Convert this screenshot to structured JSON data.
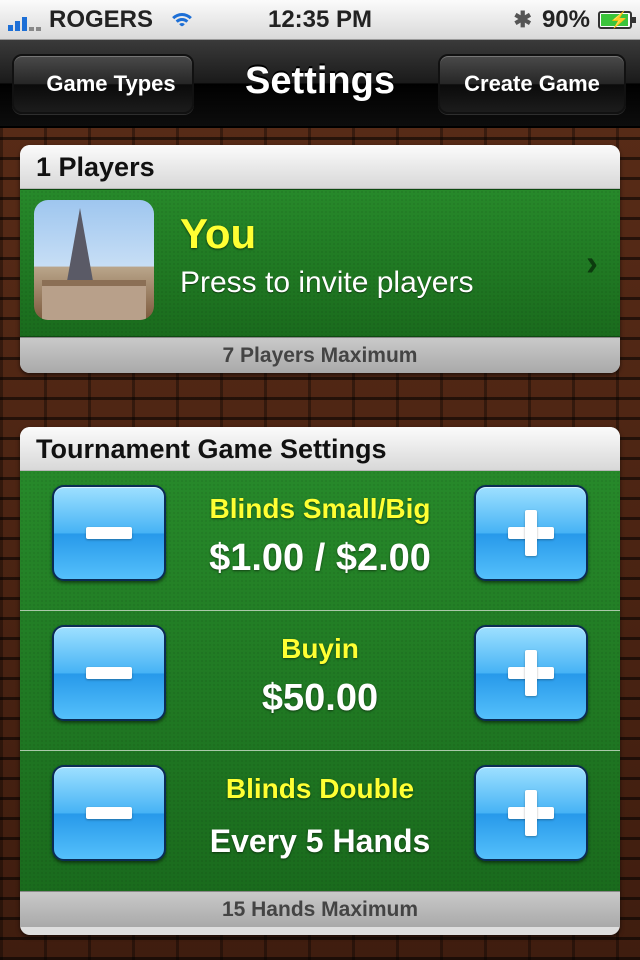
{
  "status_bar": {
    "carrier": "ROGERS",
    "time": "12:35 PM",
    "battery_percent": "90%",
    "battery_level": 0.9,
    "icons": [
      "signal-icon",
      "wifi-icon",
      "bluetooth-icon",
      "battery-icon"
    ]
  },
  "nav": {
    "back_label": "Game Types",
    "title": "Settings",
    "create_label": "Create Game"
  },
  "players_panel": {
    "header": "1 Players",
    "player_name": "You",
    "invite_text": "Press to invite players",
    "footer": "7 Players Maximum"
  },
  "settings_panel": {
    "header": "Tournament Game Settings",
    "rows": [
      {
        "label": "Blinds Small/Big",
        "value": "$1.00 / $2.00"
      },
      {
        "label": "Buyin",
        "value": "$50.00"
      },
      {
        "label": "Blinds Double",
        "value": "Every 5 Hands"
      }
    ],
    "footer": "15 Hands Maximum"
  },
  "colors": {
    "felt_green": "#1f7a22",
    "label_yellow": "#ffff33",
    "stepper_blue": "#46b3f5",
    "brick": "#4a2414"
  }
}
